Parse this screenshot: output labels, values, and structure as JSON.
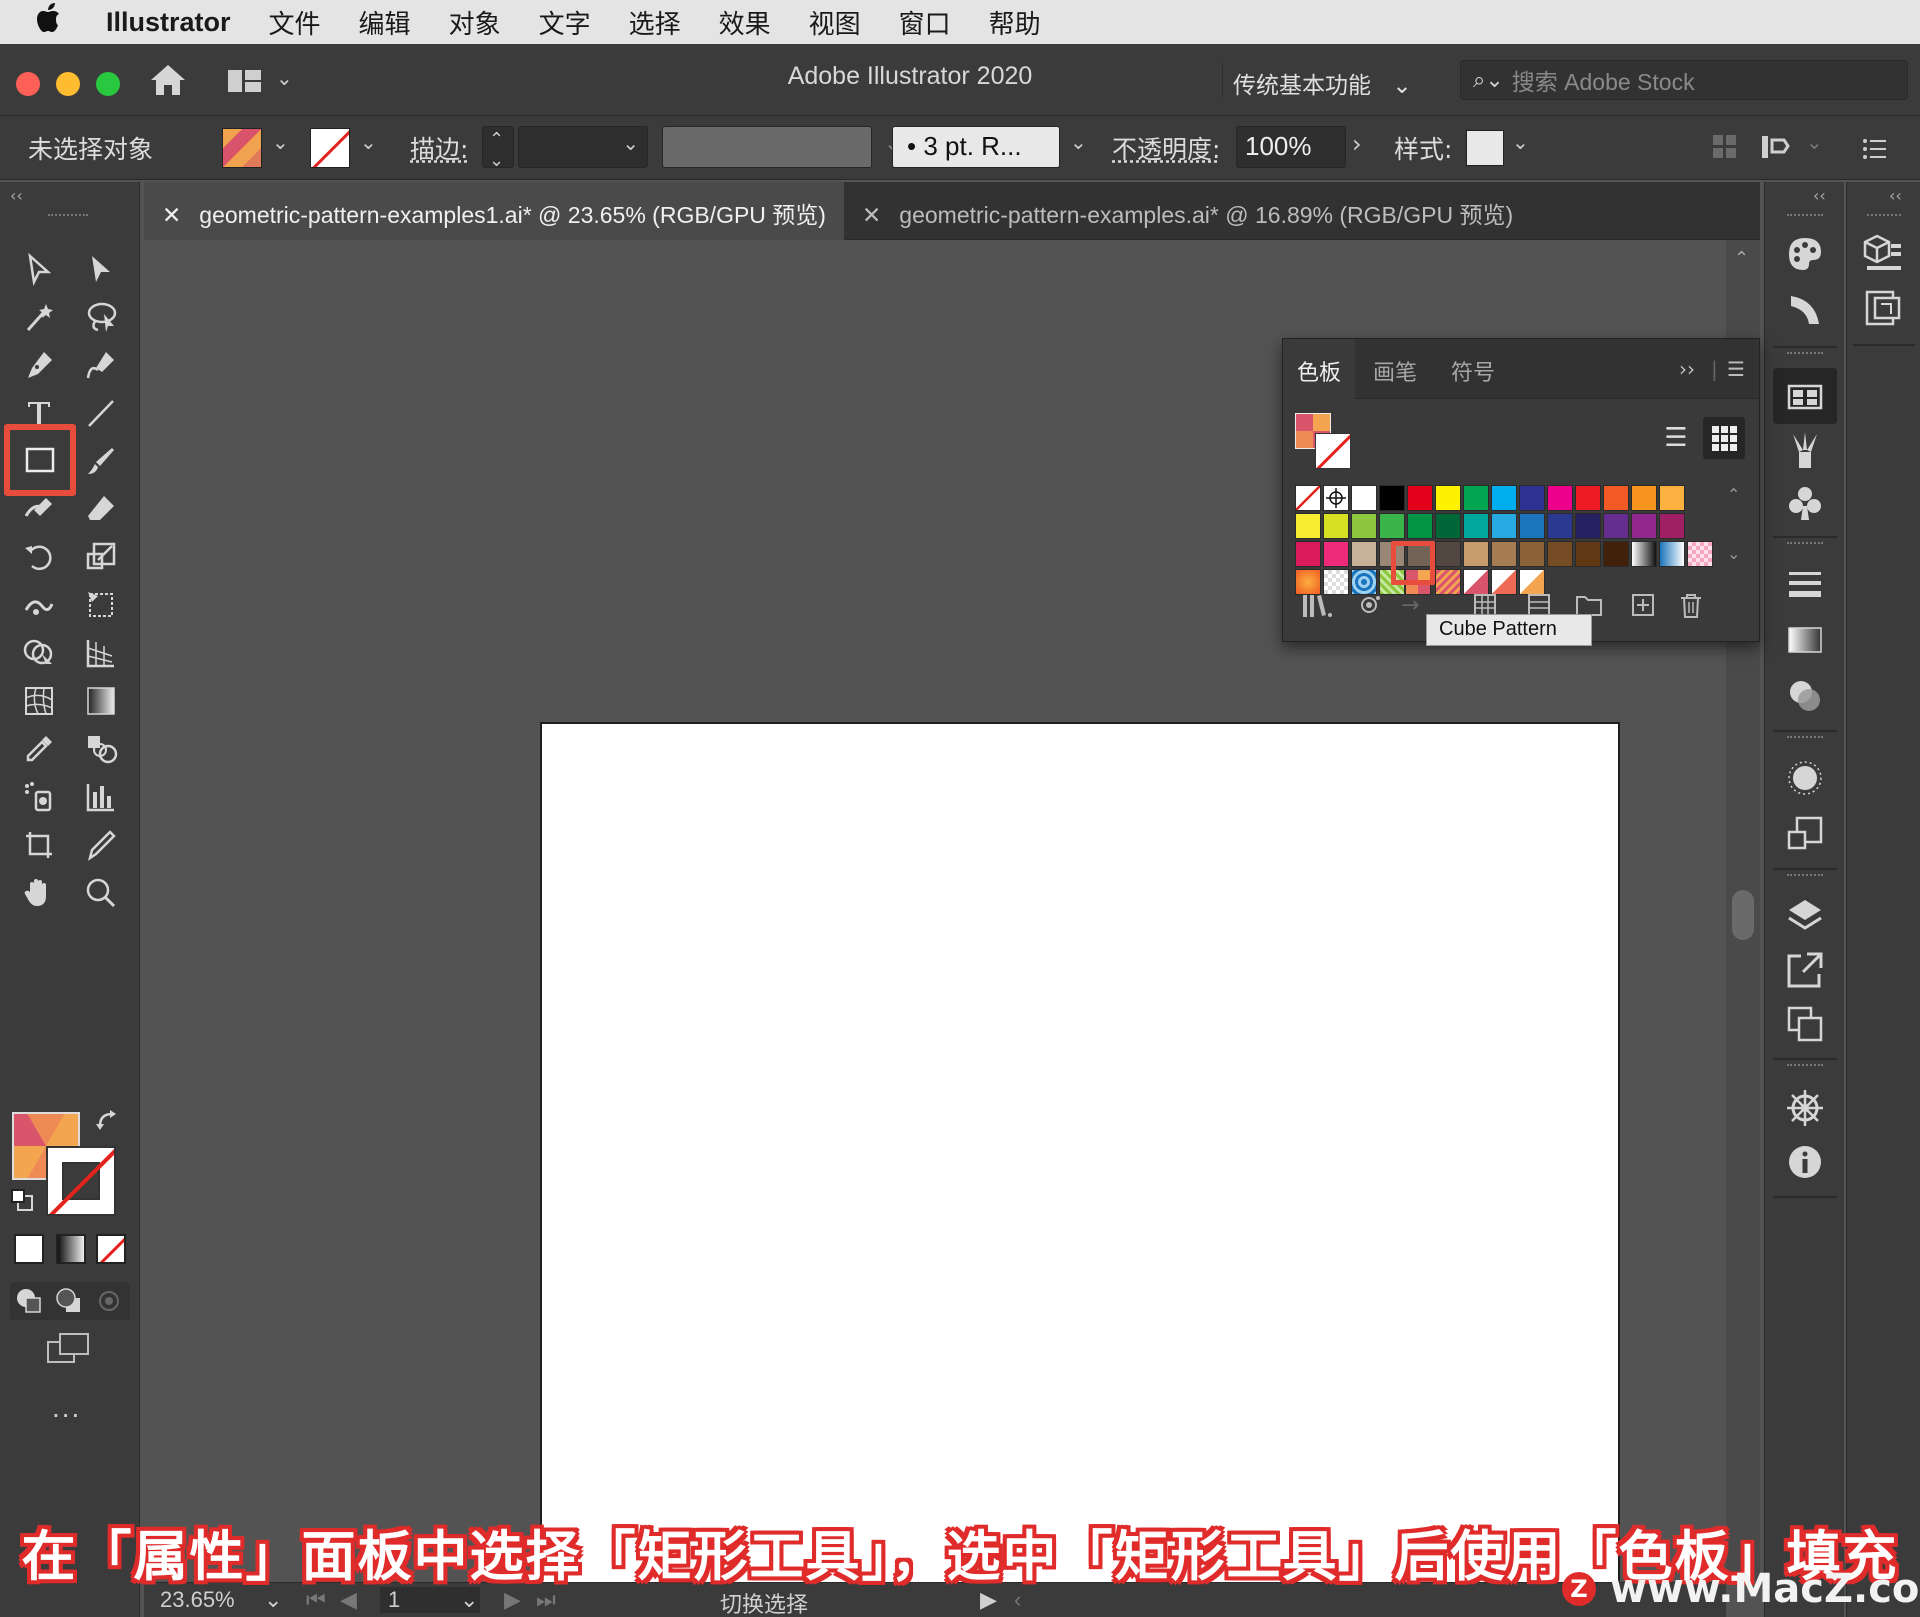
{
  "menubar": {
    "apple": "",
    "app_name": "Illustrator",
    "items": [
      "文件",
      "编辑",
      "对象",
      "文字",
      "选择",
      "效果",
      "视图",
      "窗口",
      "帮助"
    ]
  },
  "titlebar": {
    "title": "Adobe Illustrator 2020",
    "workspace": "传统基本功能",
    "stock_placeholder": "搜索 Adobe Stock"
  },
  "controlbar": {
    "selection_status": "未选择对象",
    "stroke_label": "描边:",
    "brush_value": "• 3 pt. R...",
    "opacity_label": "不透明度:",
    "opacity_value": "100%",
    "style_label": "样式:"
  },
  "tabs": [
    {
      "label": "geometric-pattern-examples1.ai* @ 23.65% (RGB/GPU 预览)",
      "active": true
    },
    {
      "label": "geometric-pattern-examples.ai* @ 16.89% (RGB/GPU 预览)",
      "active": false
    }
  ],
  "tools": {
    "selected": "rectangle-tool",
    "more_label": "..."
  },
  "swatches_panel": {
    "tabs": [
      "色板",
      "画笔",
      "符号"
    ],
    "active_tab": "色板",
    "tooltip": "Cube Pattern",
    "highlighted_swatch": "Cube Pattern",
    "colors": {
      "row1": [
        "none",
        "registration",
        "#ffffff",
        "#000000",
        "#e3001b",
        "#fff200",
        "#00a651",
        "#00aeef",
        "#2e3192",
        "#ec008c",
        "#ed1c24",
        "#f15a24",
        "#f7941d",
        "#fbb040"
      ],
      "row2": [
        "#f9ed32",
        "#d7df23",
        "#8dc63f",
        "#39b54a",
        "#009444",
        "#006838",
        "#00a79d",
        "#27aae1",
        "#1c75bc",
        "#2b3990",
        "#262262",
        "#662d91",
        "#92278f",
        "#9e1f63"
      ],
      "row3": [
        "#da1c5c",
        "#ee2a7b",
        "#c7b299",
        "#998675",
        "#736357",
        "#534741",
        "#c69c6d",
        "#a67c52",
        "#8c6239",
        "#754c24",
        "#603813",
        "#42210b",
        "gradient-bw",
        "gradient-blue"
      ]
    }
  },
  "statusbar": {
    "zoom": "23.65%",
    "artboard": "1",
    "toggle": "切换选择"
  },
  "caption": "在「属性」面板中选择「矩形工具」，选中「矩形工具」后使用「色板」填充",
  "watermark": "www.MacZ.com"
}
